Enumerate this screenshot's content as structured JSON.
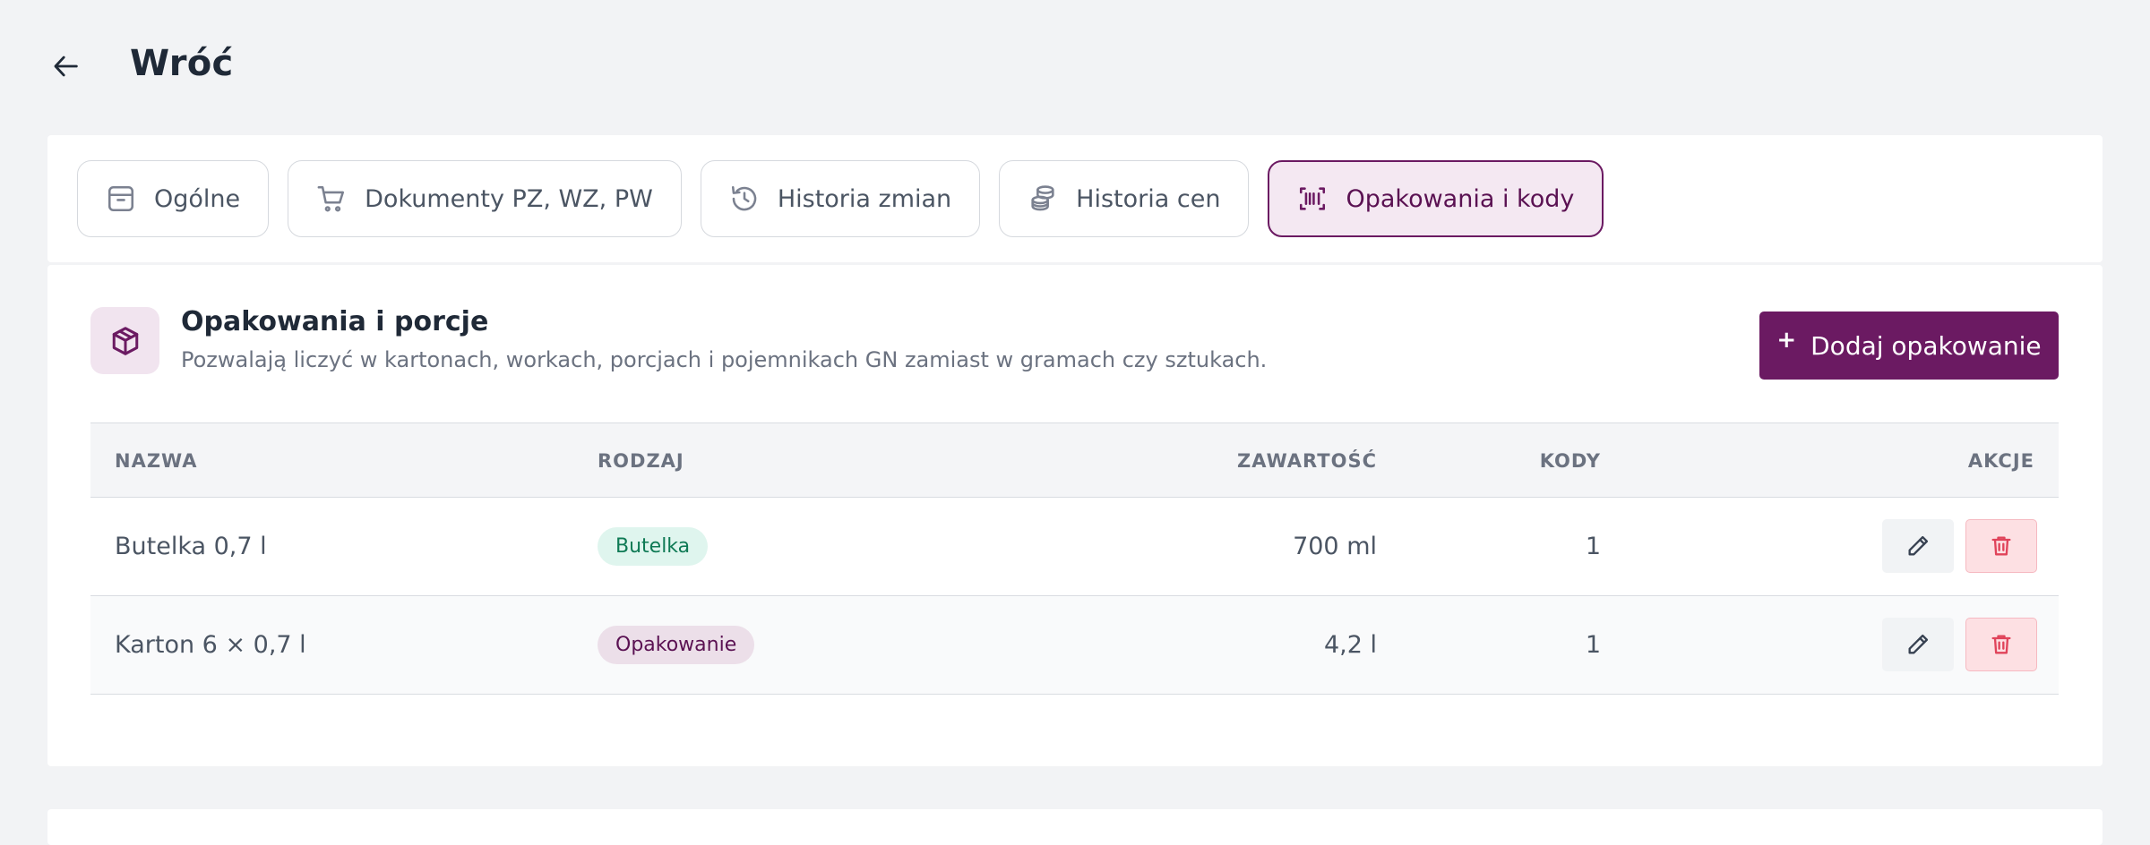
{
  "header": {
    "back_label": "Wróć"
  },
  "tabs": [
    {
      "label": "Ogólne",
      "icon": "archive-icon",
      "active": false
    },
    {
      "label": "Dokumenty PZ, WZ, PW",
      "icon": "cart-icon",
      "active": false
    },
    {
      "label": "Historia zmian",
      "icon": "history-icon",
      "active": false
    },
    {
      "label": "Historia cen",
      "icon": "coins-icon",
      "active": false
    },
    {
      "label": "Opakowania i kody",
      "icon": "barcode-icon",
      "active": true
    }
  ],
  "section": {
    "icon": "package-icon",
    "title": "Opakowania i porcje",
    "subtitle": "Pozwalają liczyć w kartonach, workach, porcjach i pojemnikach GN zamiast w gramach czy sztukach.",
    "add_button": {
      "plus": "+",
      "label": "Dodaj opakowanie"
    }
  },
  "table": {
    "columns": [
      "NAZWA",
      "RODZAJ",
      "ZAWARTOŚĆ",
      "KODY",
      "AKCJE"
    ],
    "rows": [
      {
        "name": "Butelka 0,7 l",
        "type": "Butelka",
        "content": "700 ml",
        "codes": "1"
      },
      {
        "name": "Karton 6 × 0,7 l",
        "type": "Opakowanie",
        "content": "4,2 l",
        "codes": "1"
      }
    ]
  },
  "colors": {
    "accent": "#6b1a62",
    "active_tab_bg": "#f4e8f2",
    "badge_green_bg": "#dff5ee",
    "badge_green_text": "#0f7a55",
    "badge_purple_bg": "#ecdfe9",
    "delete": "#e0435a"
  }
}
